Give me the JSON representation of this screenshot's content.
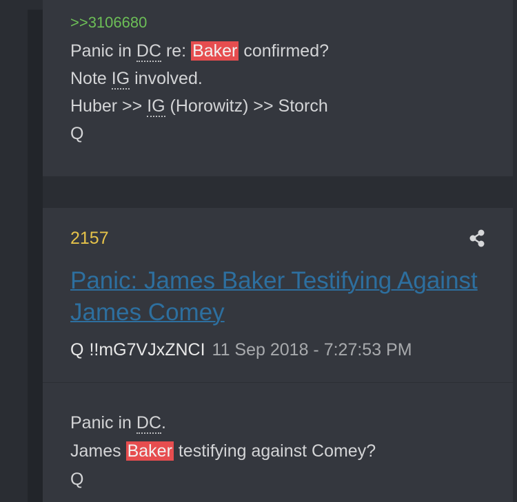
{
  "reply_post": {
    "quote_link": ">>3106680",
    "line1": {
      "pre": "Panic in ",
      "abbr": "DC",
      "mid": " re: ",
      "highlight": "Baker",
      "post": " confirmed?"
    },
    "line2": {
      "pre": "Note ",
      "abbr": "IG",
      "post": " involved."
    },
    "line3": {
      "pre": "Huber >> ",
      "abbr": "IG",
      "post": " (Horowitz) >> Storch"
    },
    "signature": "Q"
  },
  "post": {
    "number": "2157",
    "title": "Panic: James Baker Testifying Against James Comey",
    "author": "Q",
    "tripcode": "!!mG7VJxZNCI",
    "datetime": "11 Sep 2018 - 7:27:53 PM",
    "body": {
      "line1": {
        "pre": "Panic in ",
        "abbr": "DC",
        "post": "."
      },
      "line2": {
        "pre": "James ",
        "highlight": "Baker",
        "post": " testifying against Comey?"
      },
      "signature": "Q"
    }
  },
  "icons": {
    "share": "share-icon"
  },
  "colors": {
    "background": "#2a2d33",
    "card": "#34373e",
    "quote_link": "#6dbf57",
    "post_number": "#e6c34a",
    "title_link": "#2d6f9f",
    "highlight": "#e64d4f"
  }
}
